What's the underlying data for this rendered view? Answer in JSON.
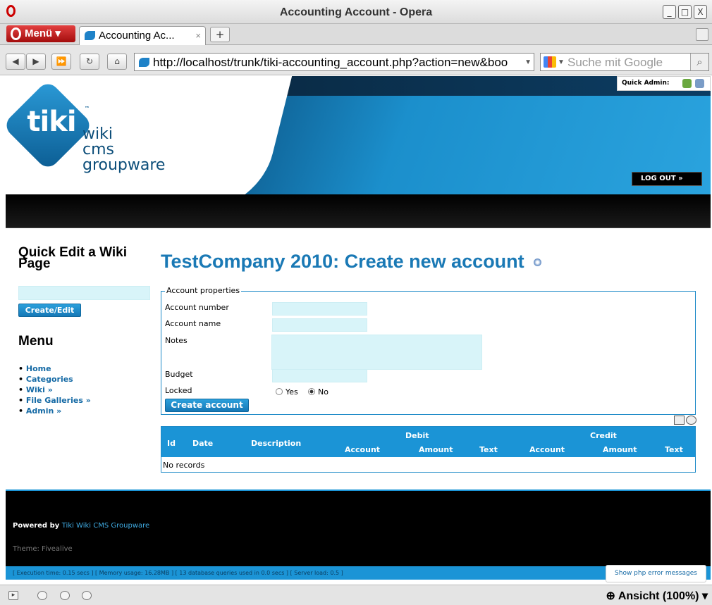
{
  "window": {
    "title": "Accounting Account - Opera",
    "controls": [
      "_",
      "□",
      "X"
    ]
  },
  "tabbar": {
    "menu_label": "Menü",
    "tab_label": "Accounting Ac...",
    "tab_close": "×",
    "new_tab": "+"
  },
  "addressbar": {
    "url": "http://localhost/trunk/tiki-accounting_account.php?action=new&boo",
    "search_placeholder": "Suche mit Google"
  },
  "header": {
    "logo_word": "tiki",
    "logo_tm": "™",
    "logo_lines": [
      "wiki",
      "cms",
      "groupware"
    ],
    "quick_admin": "Quick Admin:",
    "logout": "LOG OUT »"
  },
  "sidebar": {
    "quick_edit_title": "Quick Edit a Wiki Page",
    "quick_edit_button": "Create/Edit",
    "menu_title": "Menu",
    "menu_items": [
      "Home",
      "Categories",
      "Wiki »",
      "File Galleries »",
      "Admin »"
    ]
  },
  "main": {
    "title": "TestCompany 2010: Create new account",
    "legend": "Account properties",
    "labels": {
      "account_number": "Account number",
      "account_name": "Account name",
      "notes": "Notes",
      "budget": "Budget",
      "locked": "Locked"
    },
    "locked_options": {
      "yes": "Yes",
      "no": "No",
      "selected": "No"
    },
    "create_button": "Create account"
  },
  "table": {
    "headers": {
      "id": "Id",
      "date": "Date",
      "description": "Description",
      "debit": "Debit",
      "credit": "Credit",
      "account": "Account",
      "amount": "Amount",
      "text": "Text"
    },
    "empty": "No records"
  },
  "footer": {
    "powered_by": "Powered by",
    "powered_link": "Tiki Wiki CMS Groupware",
    "theme": "Theme: Fivealive",
    "exec": "[ Execution time: 0.15 secs ]  [ Memory usage: 16.28MB ]  [ 13 database queries used in 0.0 secs ]  [ Server load: 0.5 ]",
    "php_errors": "Show php error messages"
  },
  "statusbar": {
    "zoom": "Ansicht (100%)"
  }
}
